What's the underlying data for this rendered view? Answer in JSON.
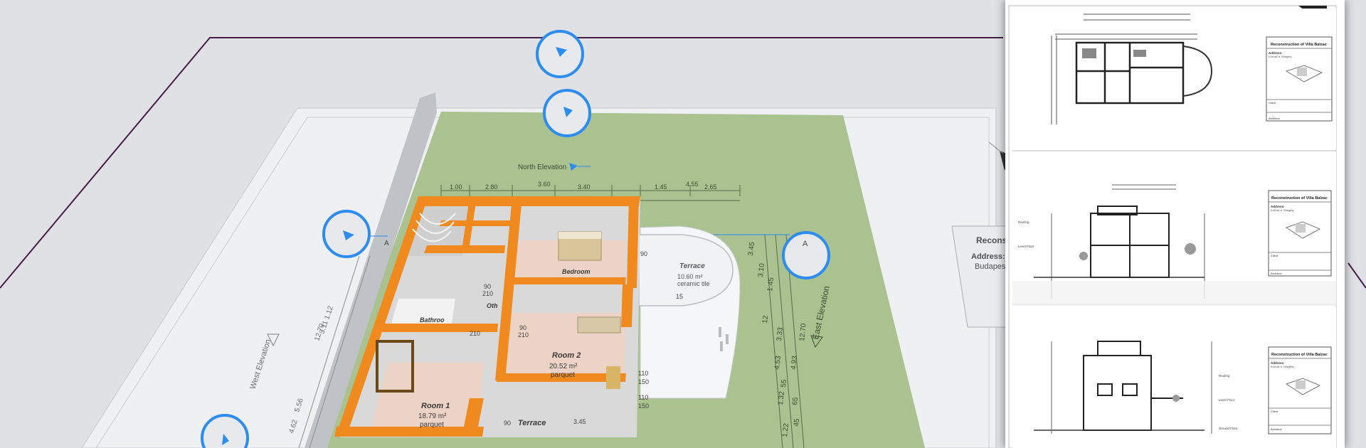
{
  "plan": {
    "north_elevation": "North Elevation",
    "west_elevation": "West Elevation",
    "east_elevation": "East Elevation",
    "dims_top": [
      "1.00",
      "2.80",
      "3.60",
      "3.40",
      "1.45",
      "4.55",
      "2.65"
    ],
    "dims_east": [
      "3.45",
      "3.10",
      "1.45",
      "12",
      "4.53",
      "3.33",
      "4.93",
      "12.70",
      "1.22",
      "1.32",
      "55",
      "45",
      "65"
    ],
    "dims_west": [
      "12.70",
      "1.12",
      "3.11",
      "5.56",
      "4.62"
    ],
    "section_marker": "A",
    "rooms": {
      "bedroom": "Bedroom",
      "bathroom": "Bathroo",
      "room1": {
        "name": "Room 1",
        "area": "18.79 m²",
        "floor": "parquet"
      },
      "room2": {
        "name": "Room 2",
        "area": "20.52 m²",
        "floor": "parquet"
      },
      "terrace_upper": {
        "name": "Terrace",
        "area": "10.60 m²",
        "floor": "ceramic tile"
      },
      "terrace_lower": "Terrace",
      "other": "Oth"
    },
    "door_tags": [
      "90",
      "210",
      "90",
      "210",
      "90",
      "210",
      "110",
      "150",
      "110",
      "150",
      "90",
      "3.45",
      "15"
    ]
  },
  "title_block_partial": {
    "title": "Reconst",
    "address_label": "Address:",
    "address_value": "Budapes"
  },
  "sheets": [
    {
      "title": "Reconstruction of Villa Balzac",
      "address_label": "Address:",
      "address_value": "Korhaz tr. Margitty",
      "client_label": "Client",
      "architect_label": "Architect"
    },
    {
      "title": "Reconstruction of Villa Balzac",
      "address_label": "Address:",
      "address_value": "Korhaz tr. Margitty",
      "client_label": "Client",
      "architect_label": "Architect"
    },
    {
      "title": "Reconstruction of Villa Balzac",
      "address_label": "Address:",
      "address_value": "Korhaz tr. Margitty",
      "client_label": "Client",
      "architect_label": "Architect"
    }
  ],
  "sheet_level_labels": [
    "Roofing",
    "Level Floor",
    "Roofing",
    "Level Floor",
    "Ground Floor"
  ],
  "colors": {
    "background": "#dfe1e5",
    "lawn": "#a9c28f",
    "wall": "#f08a1e",
    "floor": "#ecd3c6",
    "bubble": "#2d8cf0",
    "boundary": "#4a1c49"
  }
}
